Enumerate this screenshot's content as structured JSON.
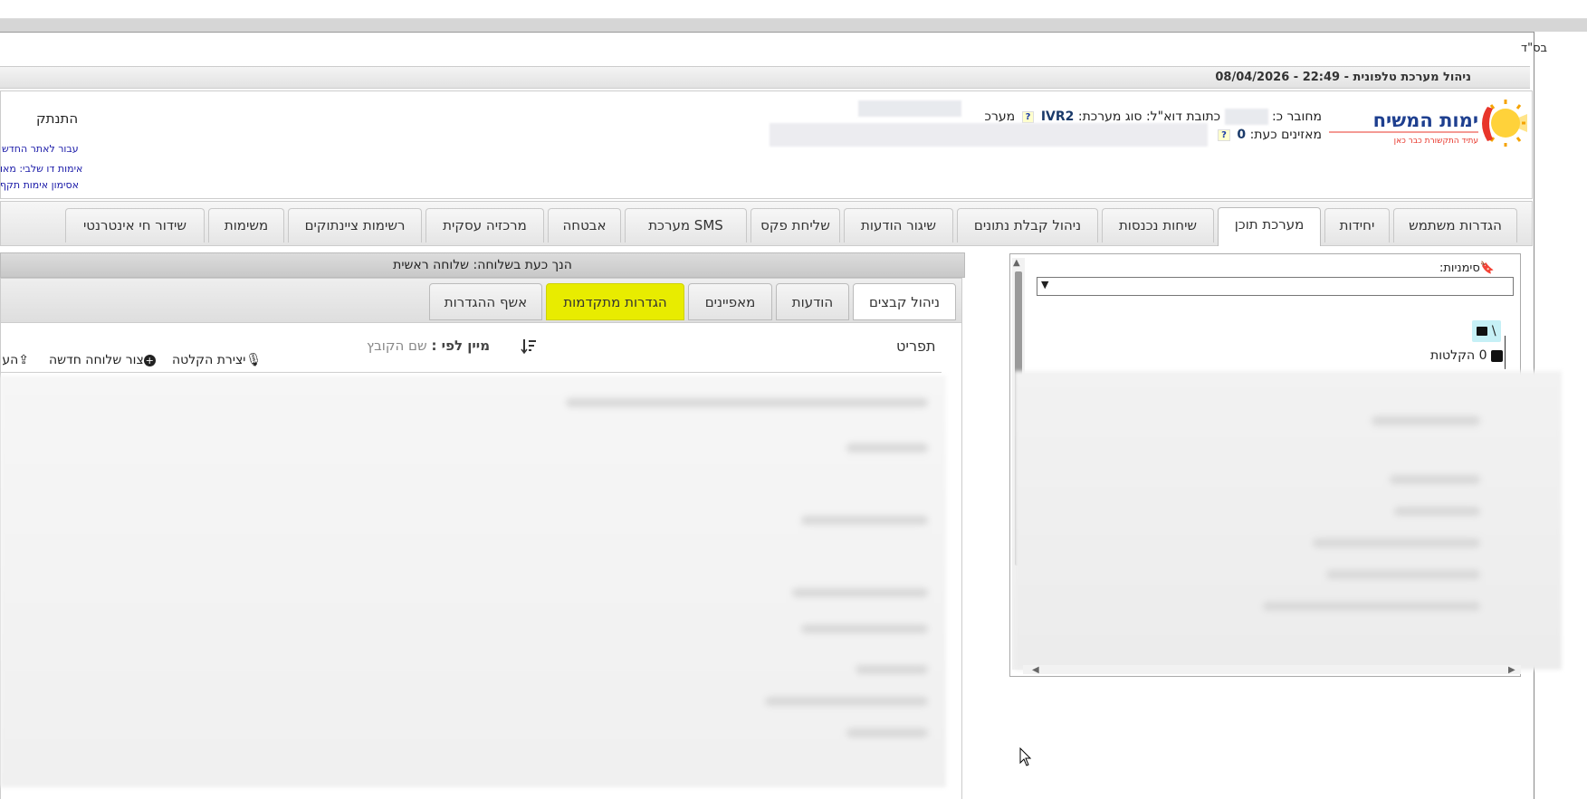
{
  "page": {
    "corner_label": "בס\"ד",
    "title": "ניהול מערכת טלפונית - 22:49 - 08/04/2026"
  },
  "header": {
    "logo_text": "ימות המשיח",
    "logo_tagline": "עתיד התקשורת כבר כאן",
    "connected_label": "מחובר כ:",
    "email_label": "כתובת דוא\"ל:",
    "system_type_label": "סוג מערכת:",
    "system_type_value": "IVR2",
    "system_label": "מערכ",
    "listeners_label": "מאזינים כעת:",
    "listeners_value": "0",
    "help_badge": "?",
    "logout_label": "התנתק",
    "side_links": [
      "עבור לאתר החדש",
      "אימות דו שלבי: מאו",
      "אסימון אימות תקף"
    ]
  },
  "main_tabs": [
    "הגדרות משתמש",
    "יחידות",
    "מערכת תוכן",
    "שיחות נכנסות",
    "ניהול קבלת נתונים",
    "שיגור הודעות",
    "שליחת פקס",
    "מערכת SMS",
    "אבטחה",
    "מרכזיה עסקית",
    "רשימות ציינתוקים",
    "משימות",
    "שידור חי אינטרנטי"
  ],
  "sidebar": {
    "bookmarks_label": "סימניות:",
    "root_label": "\\",
    "recordings_label": "0 הקלטות"
  },
  "content": {
    "location_text": "הנך כעת בשלוחה: שלוחה ראשית",
    "sub_tabs": [
      "ניהול קבצים",
      "הודעות",
      "מאפיינים",
      "הגדרות מתקדמות",
      "אשף ההגדרות"
    ],
    "menu_label": "תפריט",
    "sort_prefix": "מיין לפי :",
    "sort_value": "שם הקובץ",
    "create_recording": "יצירת הקלטה",
    "create_extension": "צור שלוחה חדשה",
    "upload": "הע"
  },
  "colors": {
    "highlight_tab": "#e8ec00",
    "link_blue": "#1a1aa8",
    "logo_blue": "#1e3f8f",
    "logo_orange": "#f5a300",
    "logo_red": "#e8352a"
  }
}
